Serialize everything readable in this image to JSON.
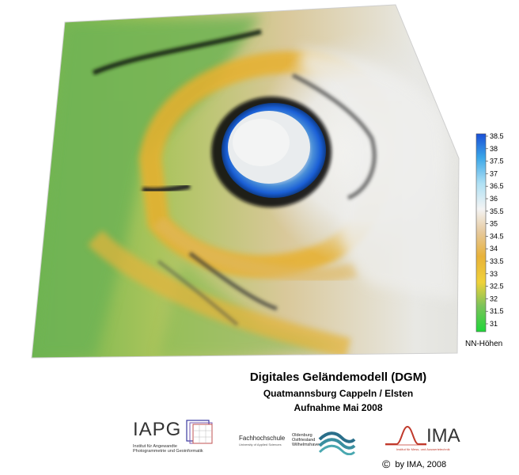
{
  "map": {
    "legend_values": [
      "38.5",
      "38",
      "37.5",
      "37",
      "36.5",
      "36",
      "35.5",
      "35",
      "34.5",
      "34",
      "33.5",
      "33",
      "32.5",
      "32",
      "31.5",
      "31"
    ],
    "legend_title": "NN-Höhen",
    "colors": {
      "high": "#1a5fd6",
      "upper": "#6fc6f0",
      "mid_high": "#f2f2f2",
      "mid": "#d9b07a",
      "mid_low": "#e8b23a",
      "low": "#2fb344",
      "lowest": "#1fd63a"
    }
  },
  "title": {
    "main": "Digitales Geländemodell (DGM)",
    "subtitle": "Quatmannsburg Cappeln / Elsten",
    "date": "Aufnahme Mai 2008"
  },
  "logos": {
    "iapg_name": "IAPG",
    "iapg_sub": "Institut für Angewandte Photogrammetrie und Geoinformatik",
    "fh_name": "Fachhochschule",
    "fh_sub": "University of Applied Sciences",
    "fh_campus": "Oldenburg Ostfriesland Wilhelmshaven",
    "ima_name": "IMA",
    "ima_sub": "Institut für Mess- und Auswertetechnik"
  },
  "copyright": "by IMA, 2008"
}
